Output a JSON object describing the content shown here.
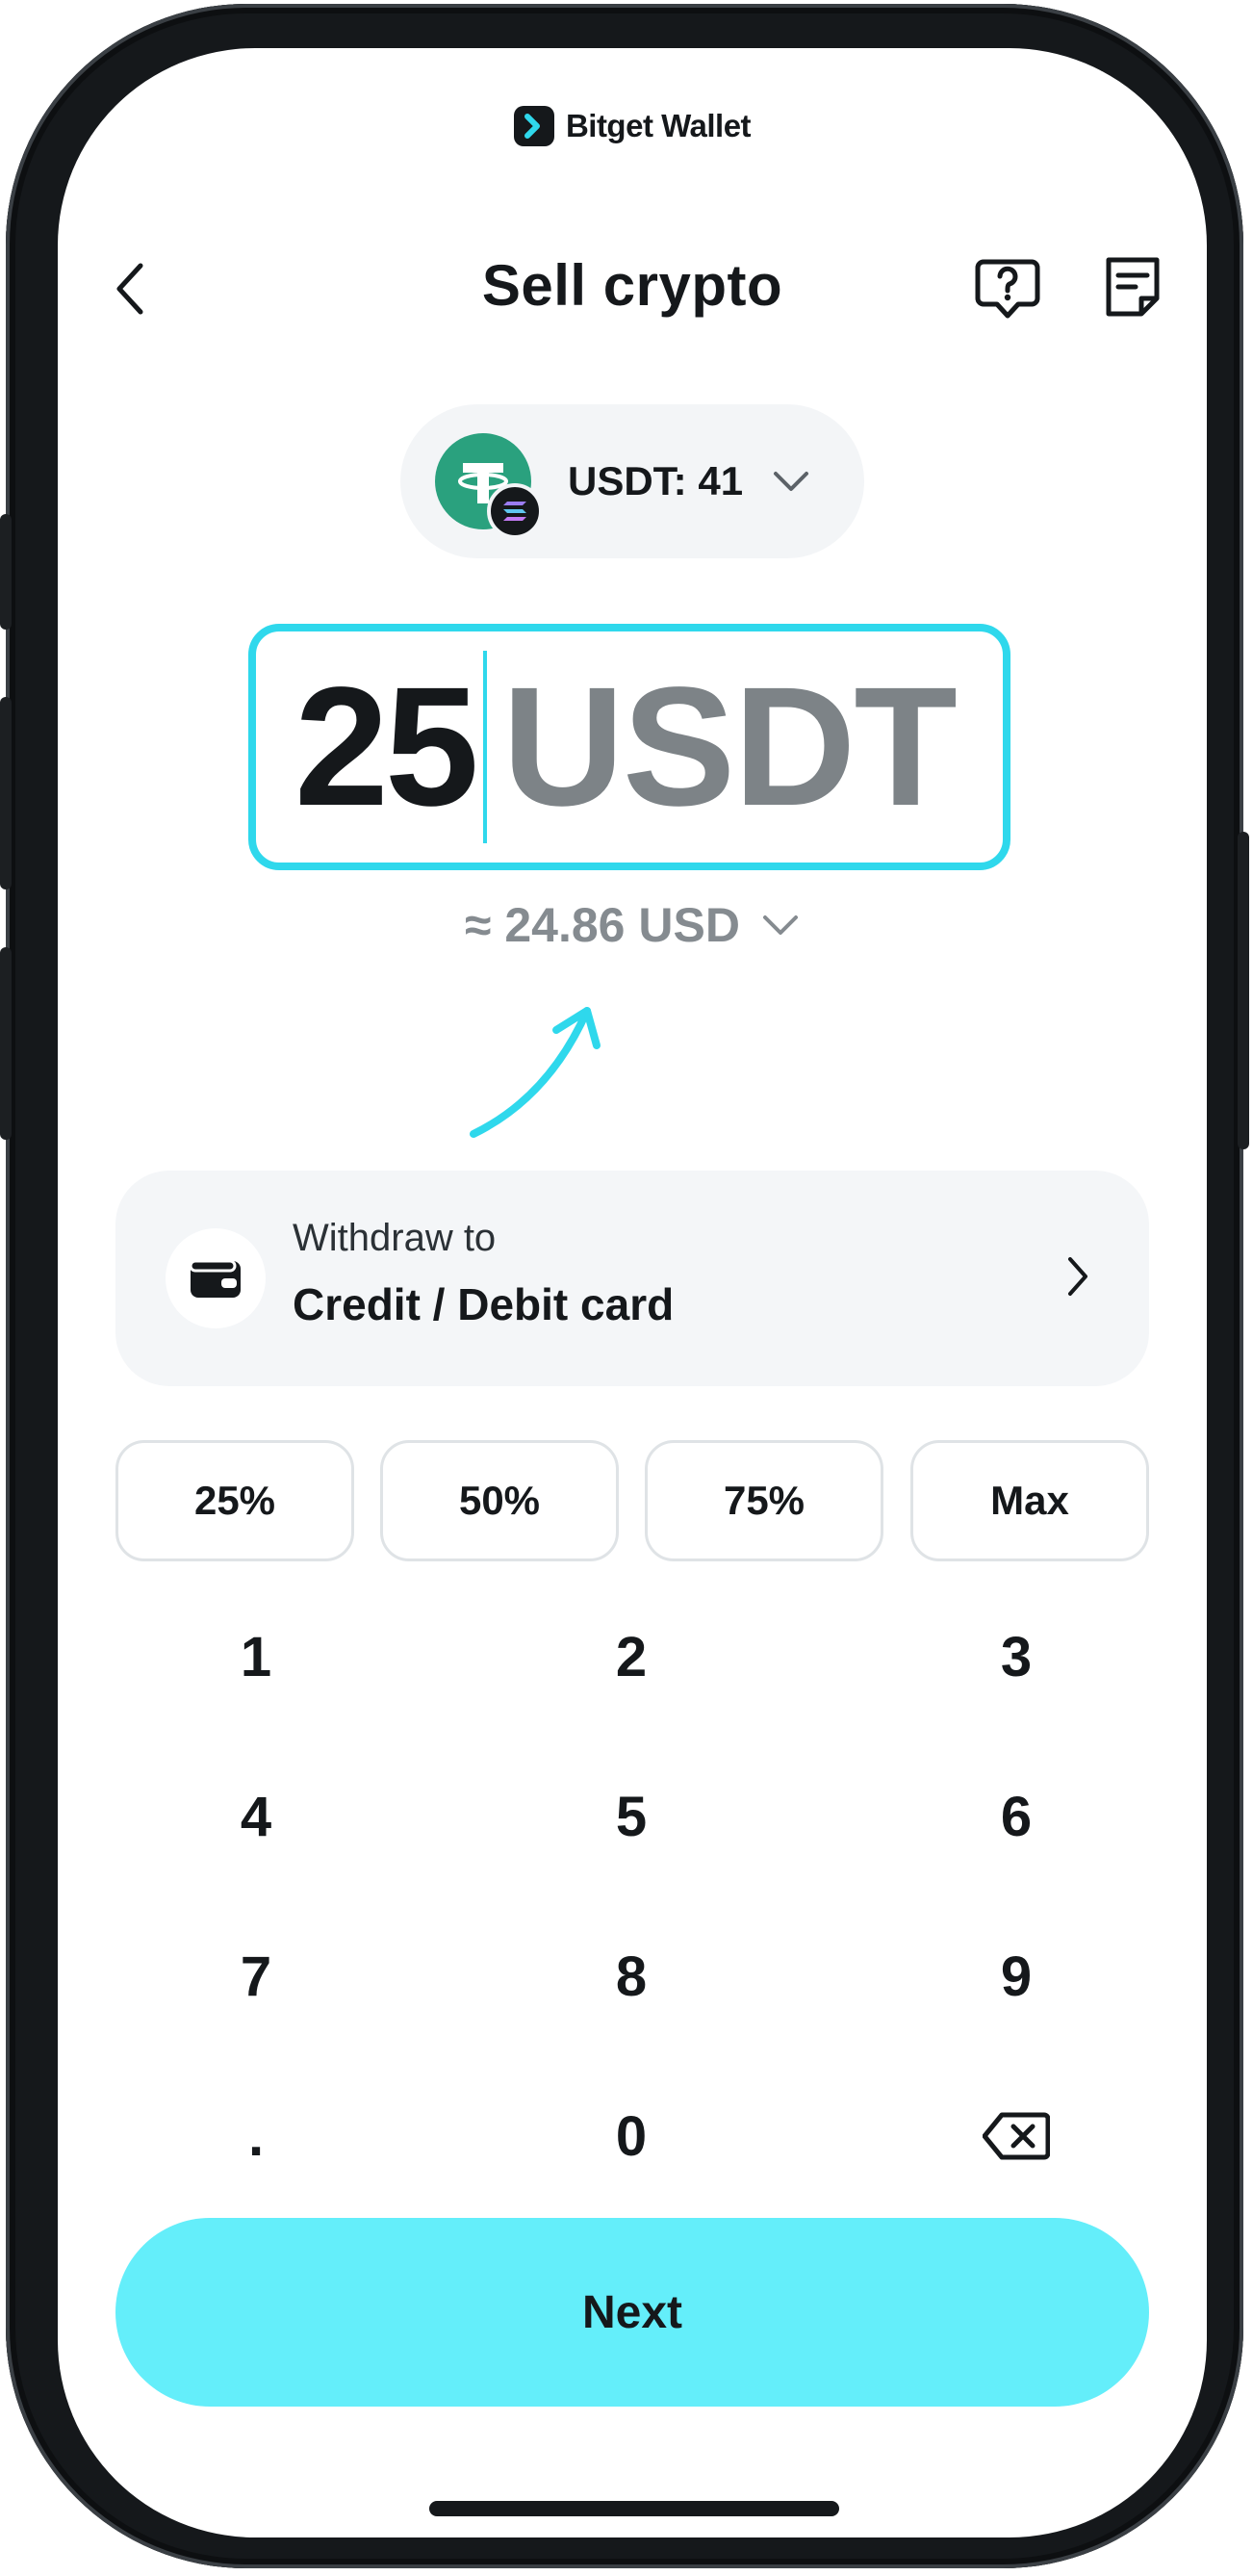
{
  "brand": {
    "name": "Bitget Wallet",
    "icon": "bitget-logo-icon"
  },
  "header": {
    "title": "Sell crypto",
    "back_icon": "chevron-left-icon",
    "help_icon": "question-chat-icon",
    "records_icon": "document-list-icon"
  },
  "token": {
    "label": "USDT: 41",
    "icon": "tether-icon",
    "chain_icon": "solana-icon"
  },
  "amount": {
    "value": "25",
    "unit": "USDT"
  },
  "fiat": {
    "label": "≈ 24.86 USD"
  },
  "withdraw": {
    "subtitle": "Withdraw to",
    "method": "Credit / Debit card",
    "icon": "wallet-icon"
  },
  "percent_buttons": [
    "25%",
    "50%",
    "75%",
    "Max"
  ],
  "keypad": [
    "1",
    "2",
    "3",
    "4",
    "5",
    "6",
    "7",
    "8",
    "9",
    ".",
    "0"
  ],
  "next_button": {
    "label": "Next"
  },
  "colors": {
    "accent": "#2fd8ec",
    "next_bg": "#64eefa",
    "tether": "#2aa17e",
    "text": "#15181b"
  }
}
